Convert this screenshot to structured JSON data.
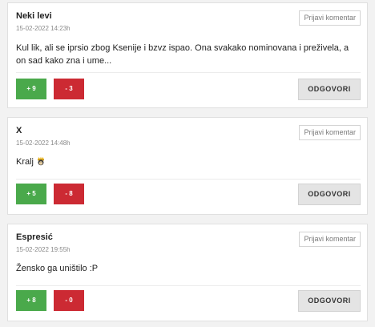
{
  "comments": [
    {
      "author": "Neki levi",
      "date": "15-02-2022 14:23h",
      "report_label": "Prijavi komentar",
      "text": "Kul lik, ali se iprsio zbog Ksenije i bzvz ispao. Ona svakako nominovana i preživela, a on sad kako zna i ume...",
      "upvotes": "+ 9",
      "downvotes": "- 3",
      "reply_label": "ODGOVORI"
    },
    {
      "author": "X",
      "date": "15-02-2022 14:48h",
      "report_label": "Prijavi komentar",
      "text": "Kralj",
      "emoji": "crown-face-icon",
      "upvotes": "+ 5",
      "downvotes": "- 8",
      "reply_label": "ODGOVORI"
    },
    {
      "author": "Espresić",
      "date": "15-02-2022 19:55h",
      "report_label": "Prijavi komentar",
      "text": "Žensko ga uništilo :P",
      "upvotes": "+ 8",
      "downvotes": "- 0",
      "reply_label": "ODGOVORI"
    }
  ],
  "colors": {
    "upvote": "#4aa94b",
    "downvote": "#cc2a33",
    "reply_bg": "#e4e4e4"
  }
}
